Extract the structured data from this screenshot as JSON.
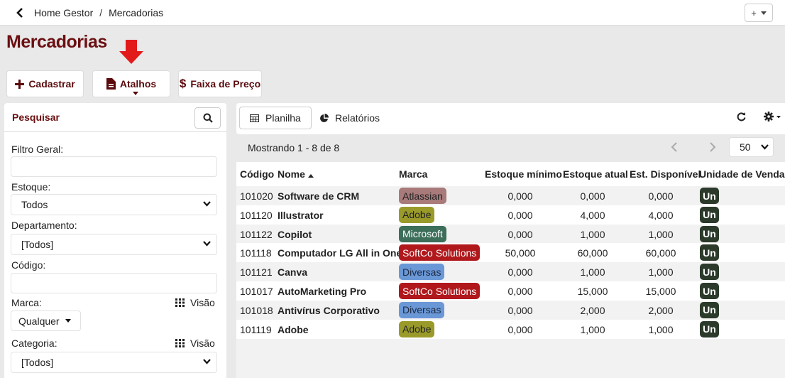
{
  "breadcrumb": {
    "home": "Home Gestor",
    "separator": "/",
    "current": "Mercadorias"
  },
  "header_action": {
    "label": "+"
  },
  "page_title": "Mercadorias",
  "toolbar": {
    "cadastrar": "Cadastrar",
    "atalhos": "Atalhos",
    "faixa": "Faixa de Preço"
  },
  "filters": {
    "title": "Pesquisar",
    "filtro_geral_label": "Filtro Geral:",
    "estoque_label": "Estoque:",
    "estoque_value": "Todos",
    "departamento_label": "Departamento:",
    "departamento_value": "[Todos]",
    "codigo_label": "Código:",
    "marca_label": "Marca:",
    "marca_value": "Qualquer",
    "visao": "Visão",
    "categoria_label": "Categoria:",
    "categoria_value": "[Todos]"
  },
  "tabs": {
    "planilha": "Planilha",
    "relatorios": "Relatórios"
  },
  "pagination": {
    "showing": "Mostrando 1 - 8 de 8",
    "per_page": "50"
  },
  "columns": [
    "Código",
    "Nome",
    "Marca",
    "Estoque mínimo",
    "Estoque atual",
    "Est. Disponível",
    "Unidade de Venda"
  ],
  "brand_colors": {
    "Atlassian": "#a87a7a",
    "Adobe": "#9a9a2a",
    "Microsoft": "#3c6e5a",
    "SoftCo Solutions": "#b0181c",
    "Diversas": "#6a97d6"
  },
  "rows": [
    {
      "codigo": "101020",
      "nome": "Software de CRM",
      "marca": "Atlassian",
      "min": "0,000",
      "atual": "0,000",
      "disp": "0,000",
      "unidade": "Un"
    },
    {
      "codigo": "101120",
      "nome": "Illustrator",
      "marca": "Adobe",
      "min": "0,000",
      "atual": "4,000",
      "disp": "4,000",
      "unidade": "Un"
    },
    {
      "codigo": "101122",
      "nome": "Copilot",
      "marca": "Microsoft",
      "min": "0,000",
      "atual": "1,000",
      "disp": "1,000",
      "unidade": "Un"
    },
    {
      "codigo": "101118",
      "nome": "Computador LG All in One",
      "marca": "SoftCo Solutions",
      "min": "50,000",
      "atual": "60,000",
      "disp": "60,000",
      "unidade": "Un"
    },
    {
      "codigo": "101121",
      "nome": "Canva",
      "marca": "Diversas",
      "min": "0,000",
      "atual": "1,000",
      "disp": "1,000",
      "unidade": "Un"
    },
    {
      "codigo": "101017",
      "nome": "AutoMarketing Pro",
      "marca": "SoftCo Solutions",
      "min": "0,000",
      "atual": "15,000",
      "disp": "15,000",
      "unidade": "Un"
    },
    {
      "codigo": "101018",
      "nome": "Antivírus Corporativo",
      "marca": "Diversas",
      "min": "0,000",
      "atual": "2,000",
      "disp": "2,000",
      "unidade": "Un"
    },
    {
      "codigo": "101119",
      "nome": "Adobe",
      "marca": "Adobe",
      "min": "0,000",
      "atual": "1,000",
      "disp": "1,000",
      "unidade": "Un"
    }
  ]
}
